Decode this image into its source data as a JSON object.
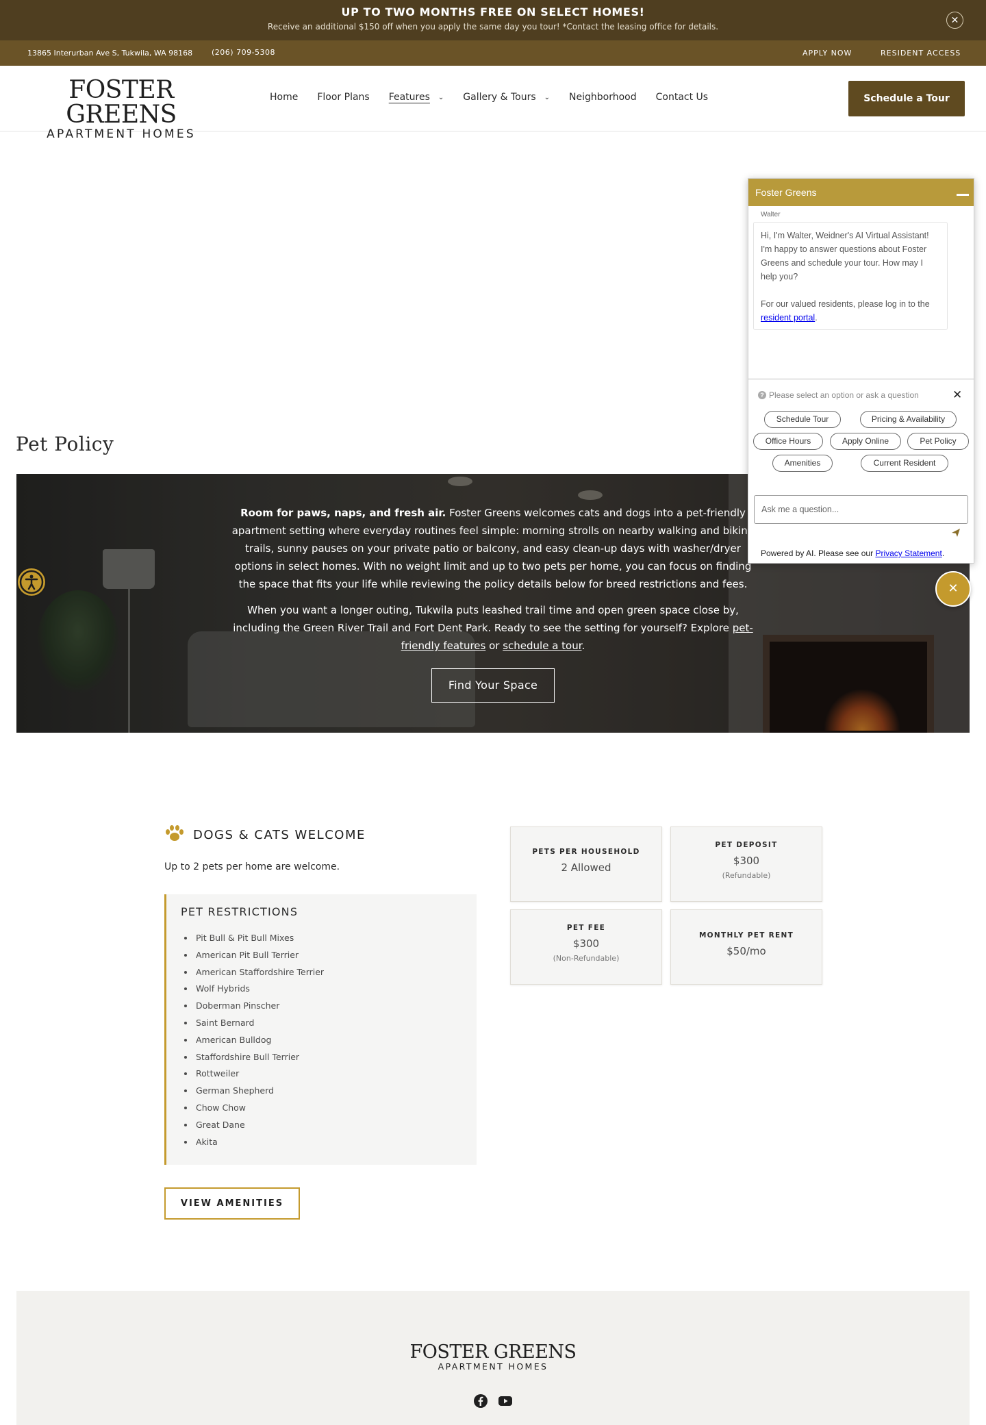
{
  "promo": {
    "title": "UP TO TWO MONTHS FREE ON SELECT HOMES!",
    "subtitle": "Receive an additional $150 off when you apply the same day you tour! *Contact the leasing office for details.",
    "close_icon": "close-icon"
  },
  "utility": {
    "address": "13865 Interurban Ave S, Tukwila, WA 98168",
    "phone": "(206) 709-5308",
    "apply": "APPLY NOW",
    "resident": "RESIDENT ACCESS"
  },
  "header": {
    "logo_main": "FOSTER GREENS",
    "logo_sub": "APARTMENT HOMES",
    "nav": {
      "home": "Home",
      "floor_plans": "Floor Plans",
      "features": "Features",
      "gallery": "Gallery & Tours",
      "neighborhood": "Neighborhood",
      "contact": "Contact Us"
    },
    "tour_button": "Schedule a Tour"
  },
  "page_title": "Pet Policy",
  "hero": {
    "p1_bold": "Room for paws, naps, and fresh air.",
    "p1_rest": " Foster Greens welcomes cats and dogs into a pet-friendly apartment setting where everyday routines feel simple: morning strolls on nearby walking and biking trails, sunny pauses on your private patio or balcony, and easy clean-up days with washer/dryer options in select homes. With no weight limit and up to two pets per home, you can focus on finding the space that fits your life while reviewing the policy details below for breed restrictions and fees.",
    "p2_text": "When you want a longer outing, Tukwila puts leashed trail time and open green space close by, including the Green River Trail and Fort Dent Park. Ready to see the setting for yourself? Explore ",
    "p2_link1": "pet-friendly features",
    "p2_mid": " or ",
    "p2_link2": "schedule a tour",
    "p2_end": ".",
    "button": "Find Your Space"
  },
  "pets": {
    "heading": "DOGS & CATS WELCOME",
    "subtext": "Up to 2 pets per home are welcome.",
    "restrictions_title": "PET RESTRICTIONS",
    "restrictions": [
      "Pit Bull & Pit Bull Mixes",
      "American Pit Bull Terrier",
      "American Staffordshire Terrier",
      "Wolf Hybrids",
      "Doberman Pinscher",
      "Saint Bernard",
      "American Bulldog",
      "Staffordshire Bull Terrier",
      "Rottweiler",
      "German Shepherd",
      "Chow Chow",
      "Great Dane",
      "Akita"
    ],
    "amenities_button": "VIEW AMENITIES",
    "cards": {
      "per_household": {
        "label": "PETS PER HOUSEHOLD",
        "value": "2 Allowed"
      },
      "deposit": {
        "label": "PET DEPOSIT",
        "value": "$300",
        "note": "(Refundable)"
      },
      "fee": {
        "label": "PET FEE",
        "value": "$300",
        "note": "(Non-Refundable)"
      },
      "rent": {
        "label": "MONTHLY PET RENT",
        "value": "$50/mo"
      }
    }
  },
  "footer": {
    "logo_main": "FOSTER GREENS",
    "logo_sub": "APARTMENT HOMES",
    "social": [
      "facebook-icon",
      "youtube-icon"
    ]
  },
  "chat": {
    "title": "Foster Greens",
    "sender": "Walter",
    "message_1": "Hi, I'm Walter, Weidner's AI Virtual Assistant! I'm happy to answer questions about Foster Greens and schedule your tour. How may I help you?",
    "message_2_text": "For our valued residents, please log in to the ",
    "message_2_link": "resident portal",
    "message_2_end": ".",
    "prompt": "Please select an option or ask a question",
    "chips": {
      "schedule": "Schedule Tour",
      "pricing": "Pricing & Availability",
      "office": "Office Hours",
      "apply": "Apply Online",
      "pet": "Pet Policy",
      "amenities": "Amenities",
      "resident": "Current Resident"
    },
    "input_placeholder": "Ask me a question...",
    "footer_text": "Powered by AI. Please see our ",
    "footer_link": "Privacy Statement",
    "footer_end": "."
  },
  "colors": {
    "promo_bg": "#4f3e20",
    "utility_bg": "#6a5327",
    "accent_gold": "#c49a2d",
    "button_brown": "#5f4a20",
    "chat_header": "#b89a3b"
  }
}
